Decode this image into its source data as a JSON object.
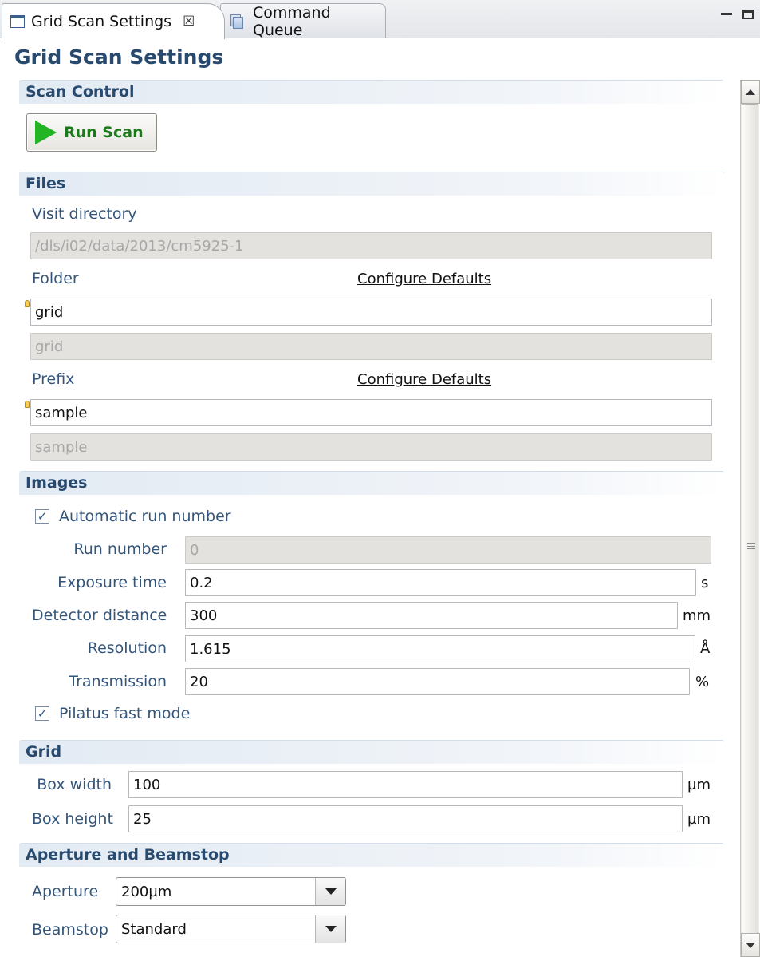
{
  "tabs": [
    {
      "label": "Grid Scan Settings",
      "close": "☒"
    },
    {
      "label": "Command Queue"
    }
  ],
  "form": {
    "title": "Grid Scan Settings",
    "scan_control": {
      "header": "Scan Control",
      "run_button": "Run Scan"
    },
    "files": {
      "header": "Files",
      "visit_label": "Visit directory",
      "visit_value": "/dls/i02/data/2013/cm5925-1",
      "folder_label": "Folder",
      "folder_defaults": "Configure Defaults",
      "folder_value": "grid",
      "folder_preview": "grid",
      "prefix_label": "Prefix",
      "prefix_defaults": "Configure Defaults",
      "prefix_value": "sample",
      "prefix_preview": "sample"
    },
    "images": {
      "header": "Images",
      "auto_run_label": "Automatic run number",
      "auto_run_checked": true,
      "run_number_label": "Run number",
      "run_number_value": "0",
      "exposure_label": "Exposure time",
      "exposure_value": "0.2",
      "exposure_unit": "s",
      "distance_label": "Detector distance",
      "distance_value": "300",
      "distance_unit": "mm",
      "resolution_label": "Resolution",
      "resolution_value": "1.615",
      "resolution_unit": "Å",
      "transmission_label": "Transmission",
      "transmission_value": "20",
      "transmission_unit": "%",
      "pilatus_label": "Pilatus fast mode",
      "pilatus_checked": true
    },
    "grid": {
      "header": "Grid",
      "box_width_label": "Box width",
      "box_width_value": "100",
      "box_width_unit": "µm",
      "box_height_label": "Box height",
      "box_height_value": "25",
      "box_height_unit": "µm"
    },
    "aperture": {
      "header": "Aperture and Beamstop",
      "aperture_label": "Aperture",
      "aperture_value": "200µm",
      "beamstop_label": "Beamstop",
      "beamstop_value": "Standard"
    }
  },
  "icons": {
    "check_glyph": "✓"
  }
}
